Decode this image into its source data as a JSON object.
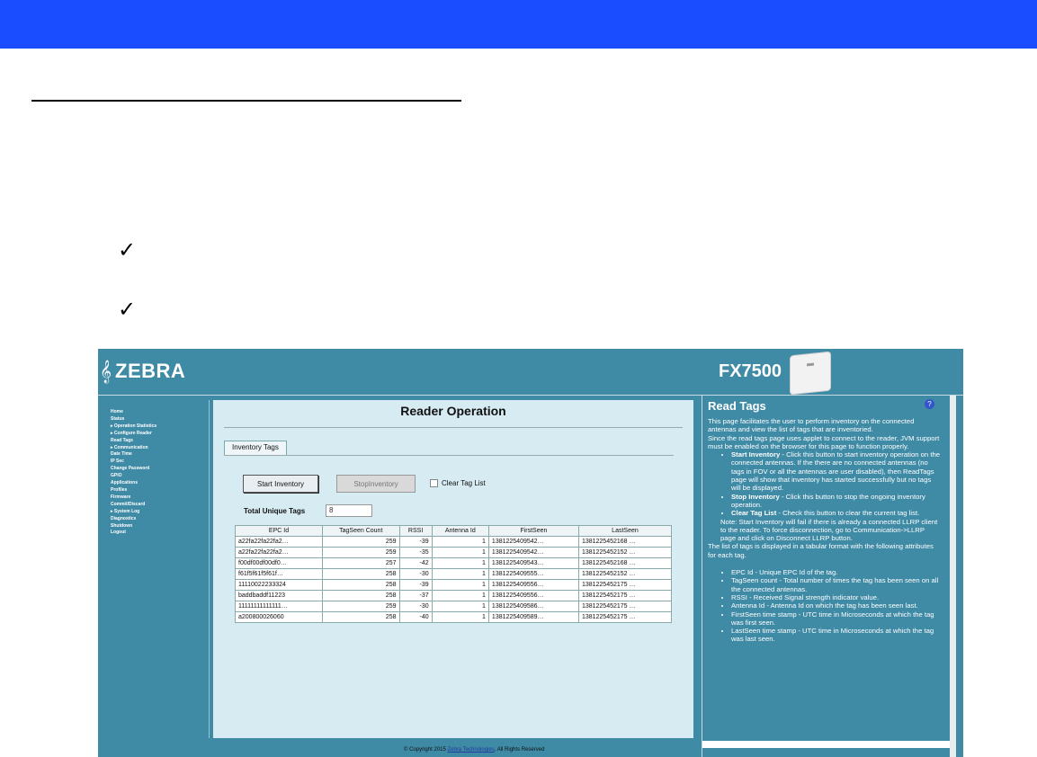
{
  "screenshot": {
    "brand": "ZEBRA",
    "model": "FX7500",
    "sidebar": {
      "items": [
        "Home",
        "Status",
        "▸ Operation Statistics",
        "▸ Configure Reader",
        "Read Tags",
        "▸ Communication",
        "Date Time",
        "IP Sec",
        "Change Password",
        "GPIO",
        "Applications",
        "Profiles",
        "Firmware",
        "Commit/Discard",
        "▸ System Log",
        "Diagnostics",
        "Shutdown",
        "Logout"
      ]
    },
    "main": {
      "title": "Reader Operation",
      "tab": "Inventory Tags",
      "start_button": "Start Inventory",
      "stop_button": "StopInventory",
      "clear_label": "Clear Tag List",
      "total_label": "Total Unique Tags",
      "total_value": "8"
    },
    "table": {
      "columns": [
        "EPC Id",
        "TagSeen Count",
        "RSSI",
        "Antenna Id",
        "FirstSeen",
        "LastSeen"
      ],
      "rows": [
        [
          "a22fa22fa22fa2…",
          "259",
          "-39",
          "1",
          "1381225409542…",
          "1381225452168 …"
        ],
        [
          "a22fa22fa22fa2…",
          "259",
          "-35",
          "1",
          "1381225409542…",
          "1381225452152 …"
        ],
        [
          "f00df00df00df0…",
          "257",
          "-42",
          "1",
          "1381225409543…",
          "1381225452168 …"
        ],
        [
          "f61f5f61f5f61f…",
          "258",
          "-30",
          "1",
          "1381225409555…",
          "1381225452152 …"
        ],
        [
          "11110022233324",
          "258",
          "-39",
          "1",
          "1381225409556…",
          "1381225452175 …"
        ],
        [
          "baddbaddf11223",
          "258",
          "-37",
          "1",
          "1381225409556…",
          "1381225452175 …"
        ],
        [
          "11111111111111…",
          "259",
          "-30",
          "1",
          "1381225409586…",
          "1381225452175 …"
        ],
        [
          "a200800026060",
          "258",
          "-40",
          "1",
          "1381225409589…",
          "1381225452175 …"
        ]
      ]
    },
    "footer": {
      "prefix": "© Copyright 2015 ",
      "link": "Zebra Technologies",
      "suffix": ", All Rights Reserved"
    },
    "help": {
      "title": "Read Tags",
      "icon_label": "?",
      "intro": "This page facilitates the user to perform inventory on the connected antennas and view the list of tags that are inventoried.",
      "intro2": "Since the read tags page uses applet to connect to the reader, JVM support must be enabled on the browser for this page to function properly.",
      "bullets1": [
        {
          "term": "Start Inventory",
          "text": " - Click this button to start inventory operation on the connected antennas. If the there are no connected antennas (no tags in FOV or all the antennas are user disabled), then ReadTags page will show that inventory has started successfully but no tags will be displayed."
        },
        {
          "term": "Stop Inventory",
          "text": " - Click this button to stop the ongoing inventory operation."
        },
        {
          "term": "Clear Tag List",
          "text": " - Check this button to clear the current tag list."
        }
      ],
      "note": "Note: Start Inventory will fail if there is already a connected LLRP client to the reader. To force disconnection, go to Communication->LLRP page and click on Disconnect LLRP button.",
      "list_intro": "The list of tags is displayed in a tabular format with the following attributes for each tag.",
      "bullets2": [
        "EPC Id - Unique EPC Id of the tag.",
        "TagSeen count - Total number of times the tag has been seen on all the connected antennas.",
        "RSSI - Received Signal strength indicator value.",
        "Antenna Id - Antenna Id on which the tag has been seen last.",
        "FirstSeen time stamp - UTC time in Microseconds at which the tag was first seen.",
        "LastSeen time stamp - UTC time in Microseconds at which the tag was last seen."
      ]
    }
  }
}
